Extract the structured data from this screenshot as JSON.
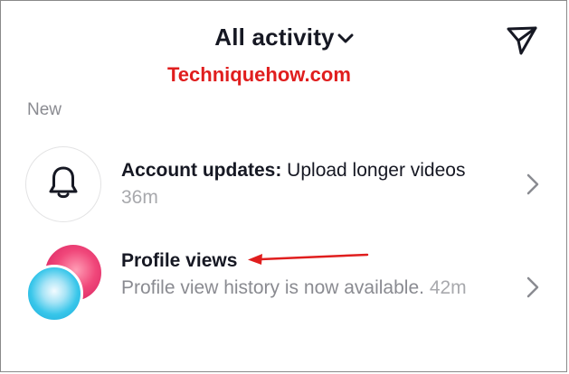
{
  "header": {
    "title": "All activity",
    "dropdown_icon": "chevron-down-icon",
    "inbox_icon": "paper-plane-icon"
  },
  "watermark": {
    "text": "Techniquehow.com",
    "color": "#e01e1e"
  },
  "section": {
    "label": "New"
  },
  "notifications": [
    {
      "icon": "bell-icon",
      "title": "Account updates:",
      "body": " Upload longer videos",
      "time": "36m"
    },
    {
      "icon": "profile-avatars",
      "title": "Profile views",
      "body": "Profile view history is now available.",
      "time": "42m"
    }
  ],
  "annotation": {
    "color": "#e01e1e",
    "icon": "red-arrow-left"
  }
}
